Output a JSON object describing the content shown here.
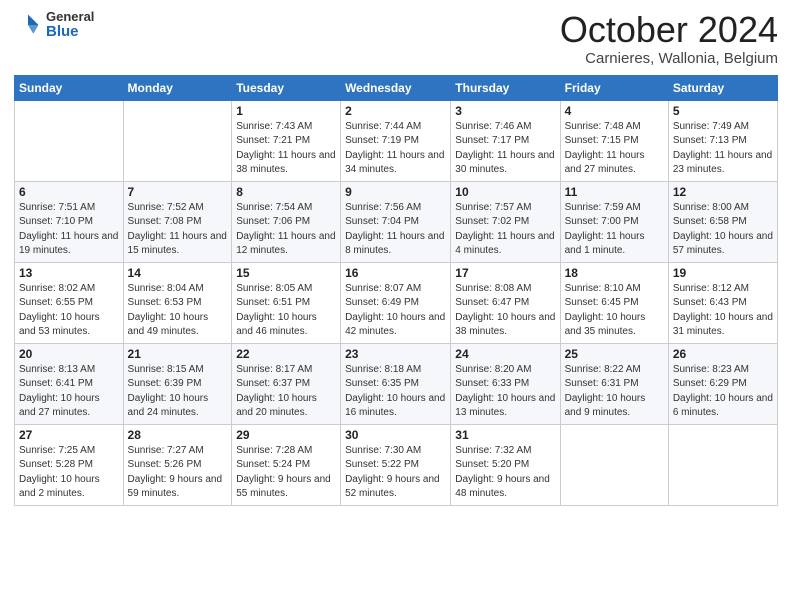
{
  "header": {
    "logo": {
      "general": "General",
      "blue": "Blue"
    },
    "title": "October 2024",
    "location": "Carnieres, Wallonia, Belgium"
  },
  "weekdays": [
    "Sunday",
    "Monday",
    "Tuesday",
    "Wednesday",
    "Thursday",
    "Friday",
    "Saturday"
  ],
  "weeks": [
    [
      {
        "day": "",
        "info": ""
      },
      {
        "day": "",
        "info": ""
      },
      {
        "day": "1",
        "info": "Sunrise: 7:43 AM\nSunset: 7:21 PM\nDaylight: 11 hours and 38 minutes."
      },
      {
        "day": "2",
        "info": "Sunrise: 7:44 AM\nSunset: 7:19 PM\nDaylight: 11 hours and 34 minutes."
      },
      {
        "day": "3",
        "info": "Sunrise: 7:46 AM\nSunset: 7:17 PM\nDaylight: 11 hours and 30 minutes."
      },
      {
        "day": "4",
        "info": "Sunrise: 7:48 AM\nSunset: 7:15 PM\nDaylight: 11 hours and 27 minutes."
      },
      {
        "day": "5",
        "info": "Sunrise: 7:49 AM\nSunset: 7:13 PM\nDaylight: 11 hours and 23 minutes."
      }
    ],
    [
      {
        "day": "6",
        "info": "Sunrise: 7:51 AM\nSunset: 7:10 PM\nDaylight: 11 hours and 19 minutes."
      },
      {
        "day": "7",
        "info": "Sunrise: 7:52 AM\nSunset: 7:08 PM\nDaylight: 11 hours and 15 minutes."
      },
      {
        "day": "8",
        "info": "Sunrise: 7:54 AM\nSunset: 7:06 PM\nDaylight: 11 hours and 12 minutes."
      },
      {
        "day": "9",
        "info": "Sunrise: 7:56 AM\nSunset: 7:04 PM\nDaylight: 11 hours and 8 minutes."
      },
      {
        "day": "10",
        "info": "Sunrise: 7:57 AM\nSunset: 7:02 PM\nDaylight: 11 hours and 4 minutes."
      },
      {
        "day": "11",
        "info": "Sunrise: 7:59 AM\nSunset: 7:00 PM\nDaylight: 11 hours and 1 minute."
      },
      {
        "day": "12",
        "info": "Sunrise: 8:00 AM\nSunset: 6:58 PM\nDaylight: 10 hours and 57 minutes."
      }
    ],
    [
      {
        "day": "13",
        "info": "Sunrise: 8:02 AM\nSunset: 6:55 PM\nDaylight: 10 hours and 53 minutes."
      },
      {
        "day": "14",
        "info": "Sunrise: 8:04 AM\nSunset: 6:53 PM\nDaylight: 10 hours and 49 minutes."
      },
      {
        "day": "15",
        "info": "Sunrise: 8:05 AM\nSunset: 6:51 PM\nDaylight: 10 hours and 46 minutes."
      },
      {
        "day": "16",
        "info": "Sunrise: 8:07 AM\nSunset: 6:49 PM\nDaylight: 10 hours and 42 minutes."
      },
      {
        "day": "17",
        "info": "Sunrise: 8:08 AM\nSunset: 6:47 PM\nDaylight: 10 hours and 38 minutes."
      },
      {
        "day": "18",
        "info": "Sunrise: 8:10 AM\nSunset: 6:45 PM\nDaylight: 10 hours and 35 minutes."
      },
      {
        "day": "19",
        "info": "Sunrise: 8:12 AM\nSunset: 6:43 PM\nDaylight: 10 hours and 31 minutes."
      }
    ],
    [
      {
        "day": "20",
        "info": "Sunrise: 8:13 AM\nSunset: 6:41 PM\nDaylight: 10 hours and 27 minutes."
      },
      {
        "day": "21",
        "info": "Sunrise: 8:15 AM\nSunset: 6:39 PM\nDaylight: 10 hours and 24 minutes."
      },
      {
        "day": "22",
        "info": "Sunrise: 8:17 AM\nSunset: 6:37 PM\nDaylight: 10 hours and 20 minutes."
      },
      {
        "day": "23",
        "info": "Sunrise: 8:18 AM\nSunset: 6:35 PM\nDaylight: 10 hours and 16 minutes."
      },
      {
        "day": "24",
        "info": "Sunrise: 8:20 AM\nSunset: 6:33 PM\nDaylight: 10 hours and 13 minutes."
      },
      {
        "day": "25",
        "info": "Sunrise: 8:22 AM\nSunset: 6:31 PM\nDaylight: 10 hours and 9 minutes."
      },
      {
        "day": "26",
        "info": "Sunrise: 8:23 AM\nSunset: 6:29 PM\nDaylight: 10 hours and 6 minutes."
      }
    ],
    [
      {
        "day": "27",
        "info": "Sunrise: 7:25 AM\nSunset: 5:28 PM\nDaylight: 10 hours and 2 minutes."
      },
      {
        "day": "28",
        "info": "Sunrise: 7:27 AM\nSunset: 5:26 PM\nDaylight: 9 hours and 59 minutes."
      },
      {
        "day": "29",
        "info": "Sunrise: 7:28 AM\nSunset: 5:24 PM\nDaylight: 9 hours and 55 minutes."
      },
      {
        "day": "30",
        "info": "Sunrise: 7:30 AM\nSunset: 5:22 PM\nDaylight: 9 hours and 52 minutes."
      },
      {
        "day": "31",
        "info": "Sunrise: 7:32 AM\nSunset: 5:20 PM\nDaylight: 9 hours and 48 minutes."
      },
      {
        "day": "",
        "info": ""
      },
      {
        "day": "",
        "info": ""
      }
    ]
  ]
}
